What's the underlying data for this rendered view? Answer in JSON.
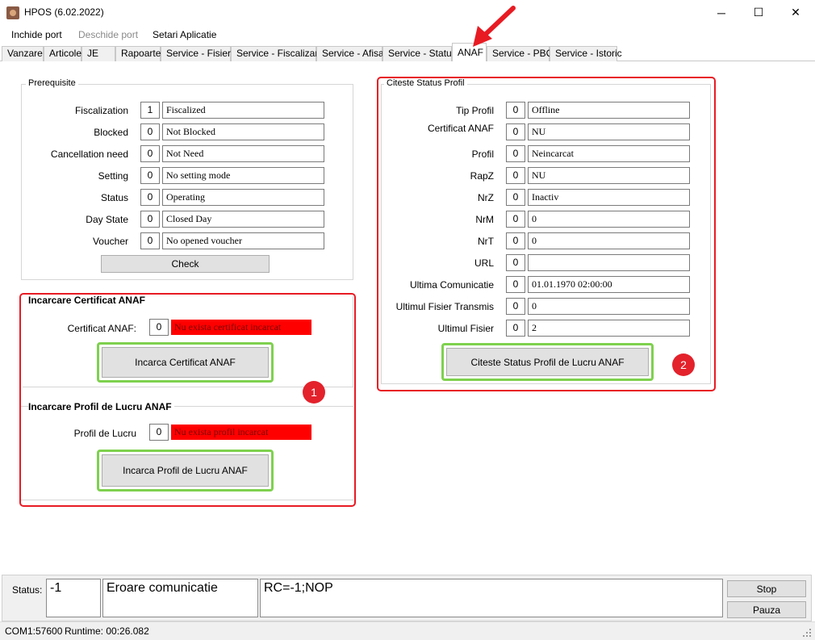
{
  "window": {
    "title": "HPOS (6.02.2022)",
    "minimize": "─",
    "maximize": "☐",
    "close": "✕"
  },
  "menu": {
    "inchide_port": "Inchide port",
    "deschide_port": "Deschide port",
    "setari": "Setari Aplicatie"
  },
  "tabs": [
    "Vanzare",
    "Articole",
    "JE",
    "Rapoarte",
    "Service - Fisiere",
    "Service - Fiscalizare",
    "Service - Afisaj",
    "Service - Status",
    "ANAF",
    "Service - PBC",
    "Service - Istoric"
  ],
  "active_tab": "ANAF",
  "prerequisite": {
    "title": "Prerequisite",
    "rows": [
      {
        "label": "Fiscalization",
        "num": "1",
        "value": "Fiscalized"
      },
      {
        "label": "Blocked",
        "num": "0",
        "value": "Not Blocked"
      },
      {
        "label": "Cancellation need",
        "num": "0",
        "value": "Not Need"
      },
      {
        "label": "Setting",
        "num": "0",
        "value": "No setting mode"
      },
      {
        "label": "Status",
        "num": "0",
        "value": "Operating"
      },
      {
        "label": "Day State",
        "num": "0",
        "value": "Closed Day"
      },
      {
        "label": "Voucher",
        "num": "0",
        "value": "No opened voucher"
      }
    ],
    "check_button": "Check"
  },
  "certificat": {
    "title": "Incarcare Certificat ANAF",
    "label": "Certificat ANAF:",
    "num": "0",
    "value": "Nu exista certificat incarcat",
    "button": "Incarca Certificat ANAF"
  },
  "profil": {
    "title": "Incarcare Profil de Lucru ANAF",
    "label": "Profil de Lucru",
    "num": "0",
    "value": "Nu exista profil incarcat",
    "button": "Incarca Profil de Lucru ANAF"
  },
  "status_profil": {
    "title": "Citeste Status Profil",
    "rows": [
      {
        "label": "Tip Profil",
        "num": "0",
        "value": "Offline"
      },
      {
        "label": "Certificat ANAF",
        "num": "0",
        "value": "NU"
      },
      {
        "label": "Profil",
        "num": "0",
        "value": "Neincarcat"
      },
      {
        "label": "RapZ",
        "num": "0",
        "value": "NU"
      },
      {
        "label": "NrZ",
        "num": "0",
        "value": "Inactiv"
      },
      {
        "label": "NrM",
        "num": "0",
        "value": "0"
      },
      {
        "label": "NrT",
        "num": "0",
        "value": "0"
      },
      {
        "label": "URL",
        "num": "0",
        "value": ""
      },
      {
        "label": "Ultima Comunicatie",
        "num": "0",
        "value": "01.01.1970 02:00:00"
      },
      {
        "label": "Ultimul Fisier Transmis",
        "num": "0",
        "value": "0"
      },
      {
        "label": "Ultimul Fisier",
        "num": "0",
        "value": "2"
      }
    ],
    "button": "Citeste Status Profil de Lucru ANAF"
  },
  "badges": {
    "one": "1",
    "two": "2"
  },
  "statusbar": {
    "label": "Status:",
    "code": "-1",
    "message": "Eroare comunicatie",
    "response": "RC=-1;NOP",
    "stop": "Stop",
    "pauza": "Pauza"
  },
  "bottom": {
    "port": "COM1:57600",
    "runtime": "Runtime: 00:26.082"
  },
  "colors": {
    "red_highlight": "#e81b23",
    "green_highlight": "#7ed14e",
    "error_field": "#ff0000"
  }
}
